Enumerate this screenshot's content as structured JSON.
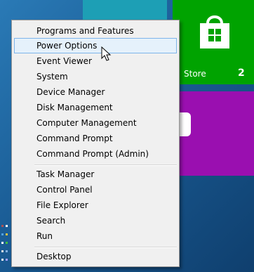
{
  "start_screen": {
    "store_tile": {
      "label": "Store",
      "badge": "2",
      "color": "#00a300"
    },
    "tile_colors": {
      "teal": "#1d9fb5",
      "purple": "#9a0fb0"
    }
  },
  "context_menu": {
    "group1": [
      "Programs and Features",
      "Power Options",
      "Event Viewer",
      "System",
      "Device Manager",
      "Disk Management",
      "Computer Management",
      "Command Prompt",
      "Command Prompt (Admin)"
    ],
    "group2": [
      "Task Manager",
      "Control Panel",
      "File Explorer",
      "Search",
      "Run"
    ],
    "group3": [
      "Desktop"
    ],
    "hovered_item": "Power Options"
  }
}
